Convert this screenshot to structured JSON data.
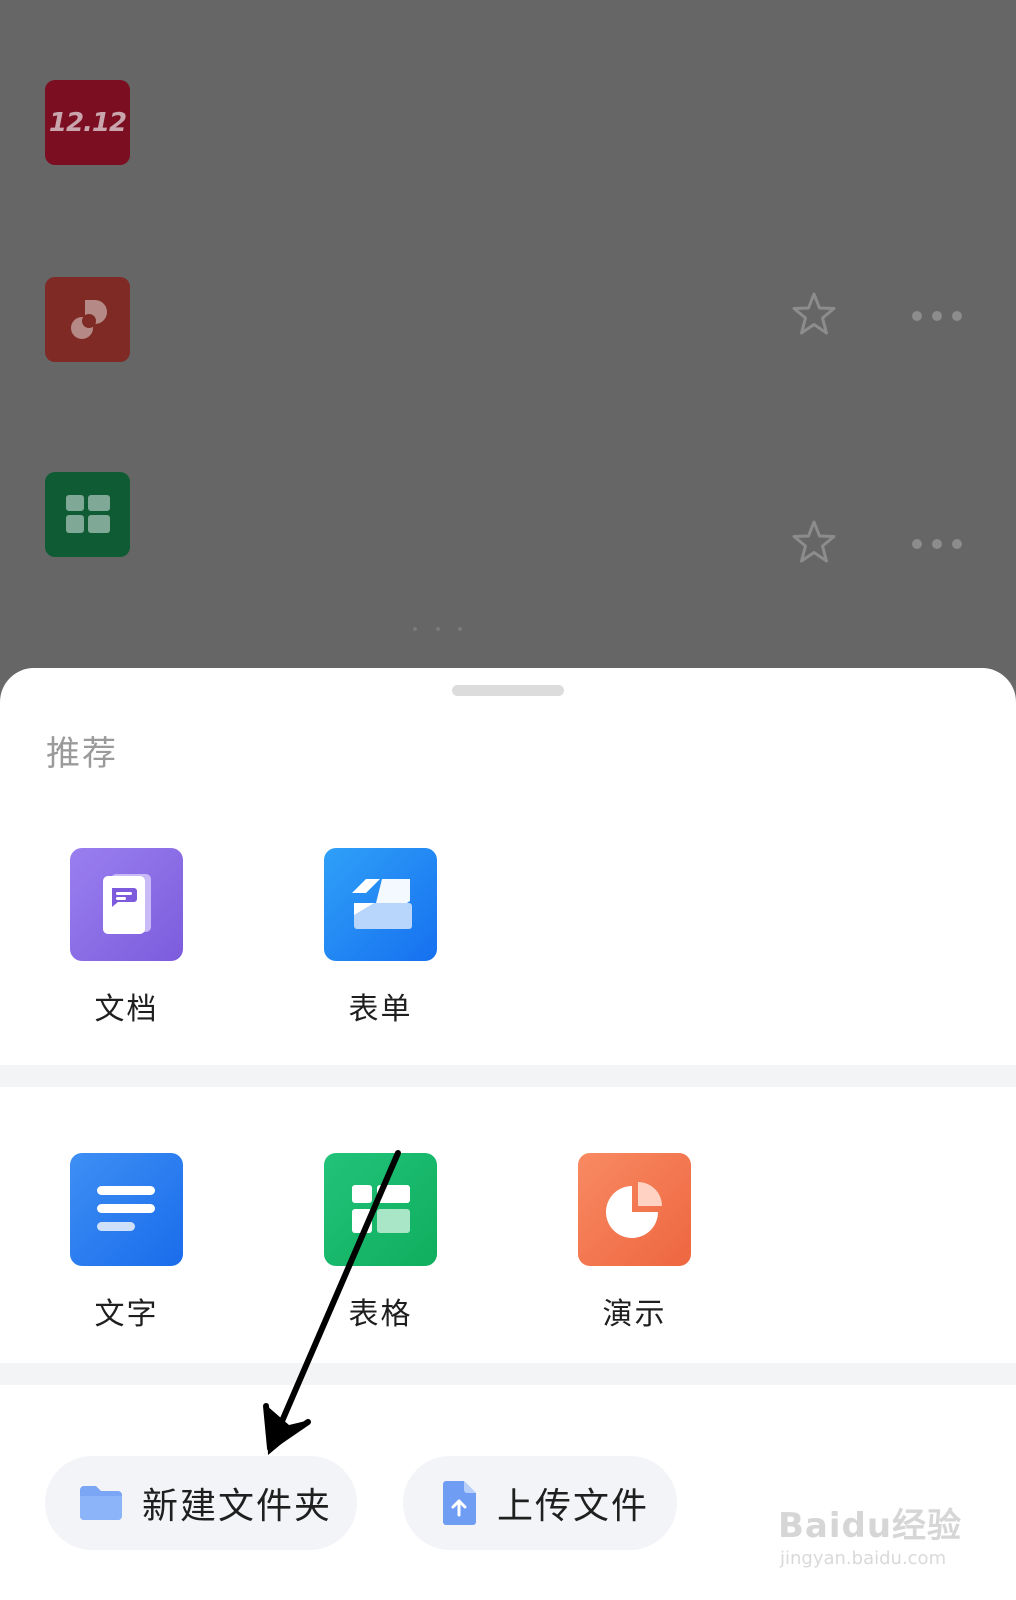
{
  "background_list": {
    "rows": [
      {
        "icon": "shopping-1212-icon",
        "icon_text": "12.12"
      },
      {
        "icon": "presentation-file-icon",
        "star": "star-icon",
        "more": "more-icon"
      },
      {
        "icon": "spreadsheet-file-icon",
        "star": "star-icon",
        "more": "more-icon"
      }
    ]
  },
  "sheet": {
    "section_title": "推荐",
    "recommended": [
      {
        "label": "文档",
        "icon": "document-icon",
        "color": "#8a6fe0"
      },
      {
        "label": "表单",
        "icon": "form-icon",
        "color": "#1f86f5"
      }
    ],
    "create": [
      {
        "label": "文字",
        "icon": "text-doc-icon",
        "color": "#2f7ef0"
      },
      {
        "label": "表格",
        "icon": "spreadsheet-icon",
        "color": "#16b466"
      },
      {
        "label": "演示",
        "icon": "presentation-icon",
        "color": "#f06b45"
      }
    ],
    "actions": {
      "new_folder": "新建文件夹",
      "upload_file": "上传文件"
    }
  },
  "watermark": {
    "main": "Baidu经验",
    "sub": "jingyan.baidu.com"
  }
}
